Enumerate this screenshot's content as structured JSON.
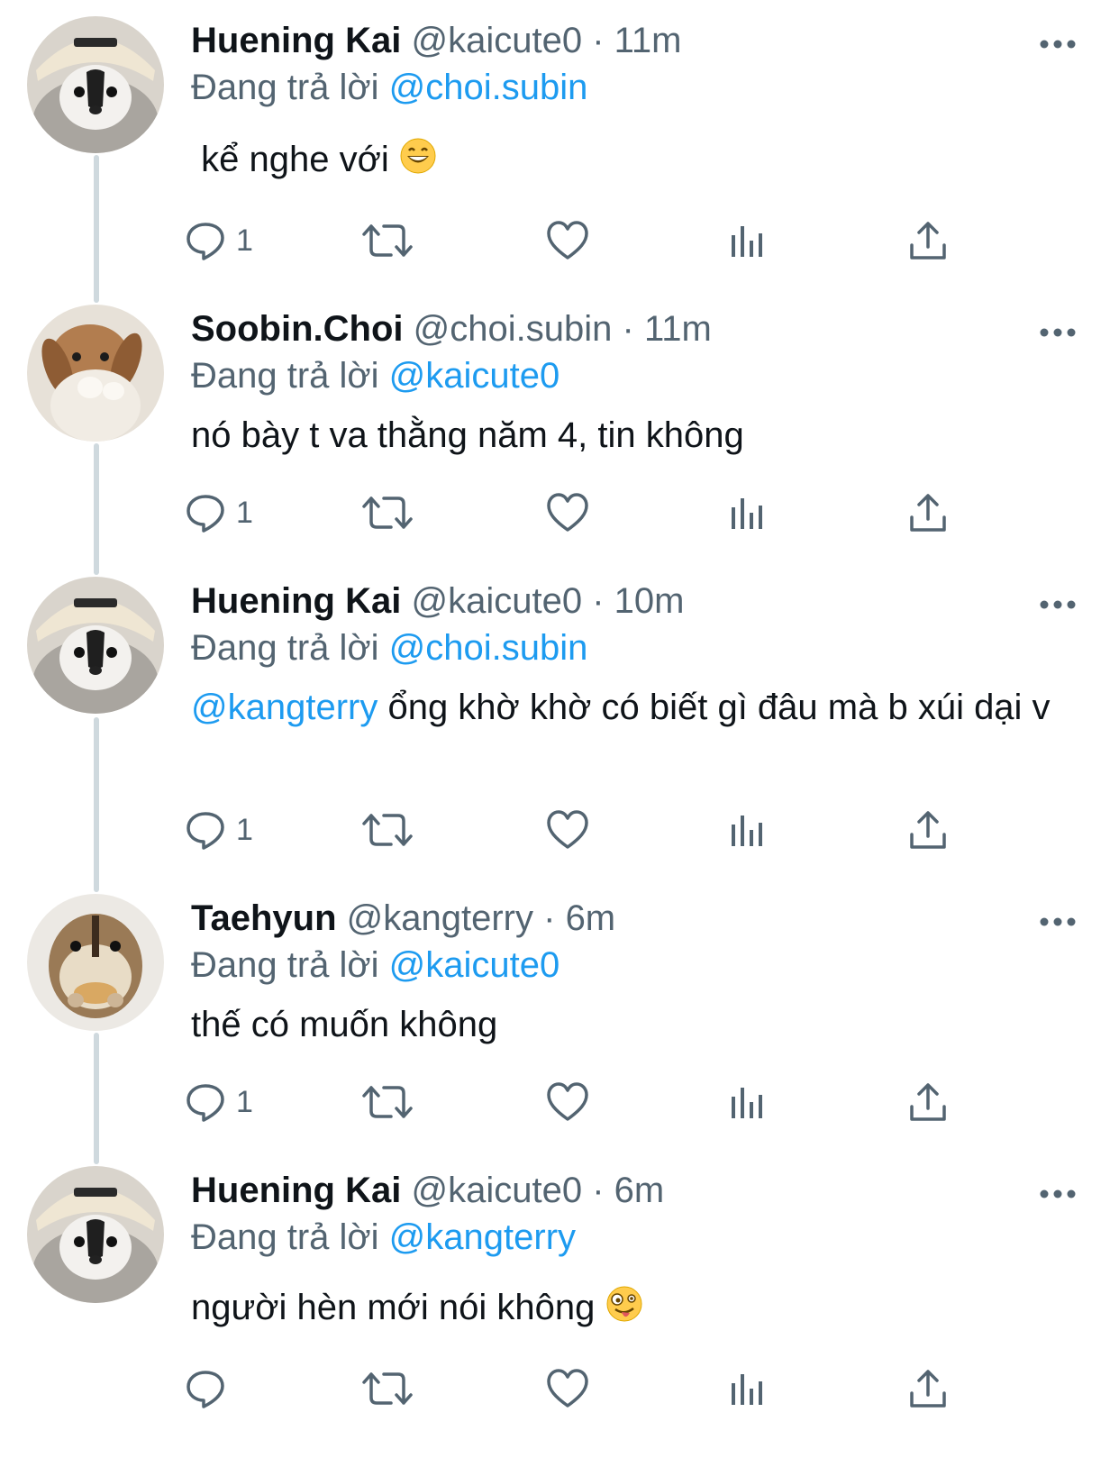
{
  "tweets": [
    {
      "name": "Huening Kai",
      "handle": "@kaicute0",
      "separator": "·",
      "time": "11m",
      "reply_prefix": "Đang trả lời",
      "reply_to": "@choi.subin",
      "text": "kể nghe với",
      "emoji": "grinning-emoji",
      "reply_count": "1",
      "avatar": "puppy-hat-avatar"
    },
    {
      "name": "Soobin.Choi",
      "handle": "@choi.subin",
      "separator": "·",
      "time": "11m",
      "reply_prefix": "Đang trả lời",
      "reply_to": "@kaicute0",
      "text": "nó bày t va thằng năm 4, tin không",
      "reply_count": "1",
      "avatar": "bunny-avatar"
    },
    {
      "name": "Huening Kai",
      "handle": "@kaicute0",
      "separator": "·",
      "time": "10m",
      "reply_prefix": "Đang trả lời",
      "reply_to": "@choi.subin",
      "text_mention": "@kangterry",
      "text": " ổng khờ khờ có biết gì đâu mà b xúi dại v",
      "reply_count": "1",
      "avatar": "puppy-hat-avatar"
    },
    {
      "name": "Taehyun",
      "handle": "@kangterry",
      "separator": "·",
      "time": "6m",
      "reply_prefix": "Đang trả lời",
      "reply_to": "@kaicute0",
      "text": "thế có muốn không",
      "reply_count": "1",
      "avatar": "chipmunk-avatar"
    },
    {
      "name": "Huening Kai",
      "handle": "@kaicute0",
      "separator": "·",
      "time": "6m",
      "reply_prefix": "Đang trả lời",
      "reply_to": "@kangterry",
      "text": "người hèn mới nói không",
      "emoji": "zany-face-emoji",
      "reply_count": "",
      "avatar": "puppy-hat-avatar"
    }
  ],
  "colors": {
    "link": "#1d9bf0",
    "secondary": "#536471",
    "thread_line": "#cfd9de"
  }
}
